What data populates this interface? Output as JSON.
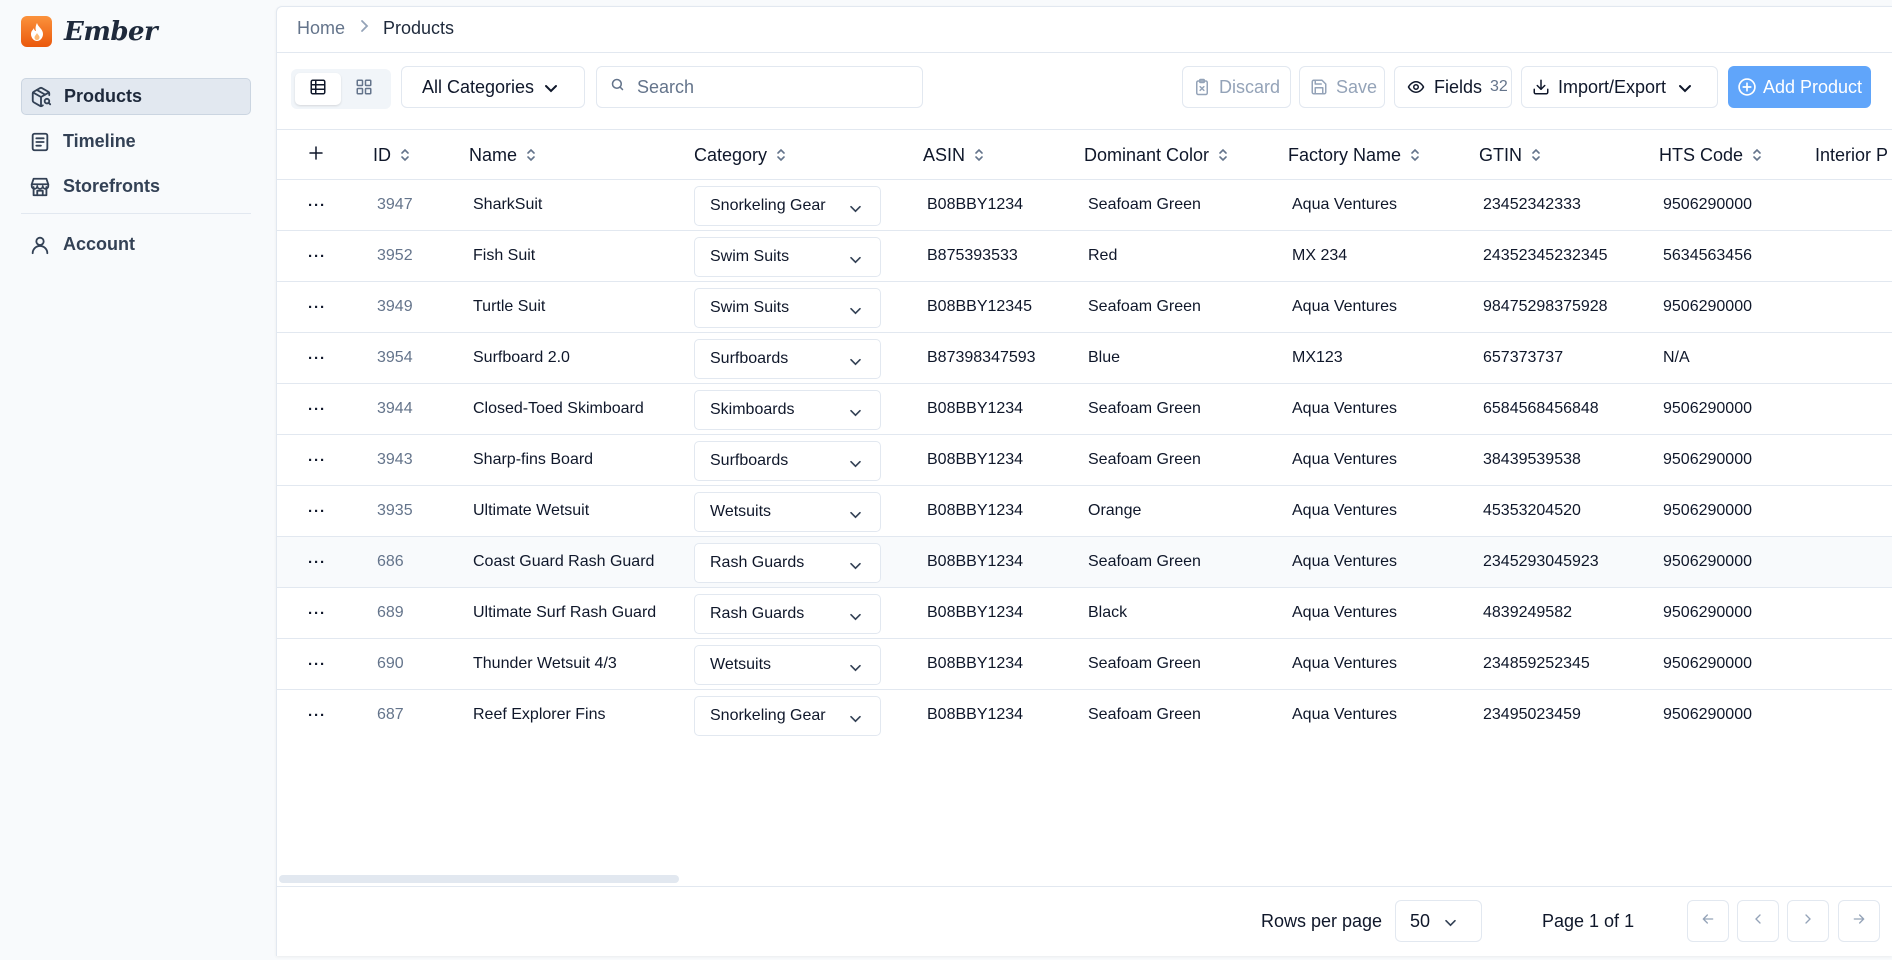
{
  "brand": {
    "name": "Ember"
  },
  "sidebar": {
    "items": [
      {
        "label": "Products",
        "icon": "package-search-icon",
        "active": true
      },
      {
        "label": "Timeline",
        "icon": "timeline-list-icon"
      },
      {
        "label": "Storefronts",
        "icon": "store-icon"
      }
    ],
    "account": {
      "label": "Account",
      "icon": "user-icon"
    }
  },
  "breadcrumb": {
    "home": "Home",
    "current": "Products"
  },
  "toolbar": {
    "category_filter": "All Categories",
    "search_placeholder": "Search",
    "discard_label": "Discard",
    "save_label": "Save",
    "fields_label": "Fields",
    "fields_count": "32",
    "import_export_label": "Import/Export",
    "add_label": "Add Product",
    "accent_color": "#60a5fa"
  },
  "table": {
    "columns": [
      "ID",
      "Name",
      "Category",
      "ASIN",
      "Dominant Color",
      "Factory Name",
      "GTIN",
      "HTS Code",
      "Interior P"
    ],
    "rows": [
      {
        "id": "3947",
        "name": "SharkSuit",
        "category": "Snorkeling Gear",
        "asin": "B08BBY1234",
        "color": "Seafoam Green",
        "factory": "Aqua Ventures",
        "gtin": "23452342333",
        "hts": "9506290000"
      },
      {
        "id": "3952",
        "name": "Fish Suit",
        "category": "Swim Suits",
        "asin": "B875393533",
        "color": "Red",
        "factory": "MX 234",
        "gtin": "24352345232345",
        "hts": "5634563456"
      },
      {
        "id": "3949",
        "name": "Turtle Suit",
        "category": "Swim Suits",
        "asin": "B08BBY12345",
        "color": "Seafoam Green",
        "factory": "Aqua Ventures",
        "gtin": "98475298375928",
        "hts": "9506290000"
      },
      {
        "id": "3954",
        "name": "Surfboard 2.0",
        "category": "Surfboards",
        "asin": "B87398347593",
        "color": "Blue",
        "factory": "MX123",
        "gtin": "657373737",
        "hts": "N/A"
      },
      {
        "id": "3944",
        "name": "Closed-Toed Skimboard",
        "category": "Skimboards",
        "asin": "B08BBY1234",
        "color": "Seafoam Green",
        "factory": "Aqua Ventures",
        "gtin": "6584568456848",
        "hts": "9506290000"
      },
      {
        "id": "3943",
        "name": "Sharp-fins Board",
        "category": "Surfboards",
        "asin": "B08BBY1234",
        "color": "Seafoam Green",
        "factory": "Aqua Ventures",
        "gtin": "38439539538",
        "hts": "9506290000"
      },
      {
        "id": "3935",
        "name": "Ultimate Wetsuit",
        "category": "Wetsuits",
        "asin": "B08BBY1234",
        "color": "Orange",
        "factory": "Aqua Ventures",
        "gtin": "45353204520",
        "hts": "9506290000"
      },
      {
        "id": "686",
        "name": "Coast Guard Rash Guard",
        "category": "Rash Guards",
        "asin": "B08BBY1234",
        "color": "Seafoam Green",
        "factory": "Aqua Ventures",
        "gtin": "2345293045923",
        "hts": "9506290000",
        "highlighted": true
      },
      {
        "id": "689",
        "name": "Ultimate Surf Rash Guard",
        "category": "Rash Guards",
        "asin": "B08BBY1234",
        "color": "Black",
        "factory": "Aqua Ventures",
        "gtin": "4839249582",
        "hts": "9506290000"
      },
      {
        "id": "690",
        "name": "Thunder Wetsuit 4/3",
        "category": "Wetsuits",
        "asin": "B08BBY1234",
        "color": "Seafoam Green",
        "factory": "Aqua Ventures",
        "gtin": "234859252345",
        "hts": "9506290000"
      },
      {
        "id": "687",
        "name": "Reef Explorer Fins",
        "category": "Snorkeling Gear",
        "asin": "B08BBY1234",
        "color": "Seafoam Green",
        "factory": "Aqua Ventures",
        "gtin": "23495023459",
        "hts": "9506290000"
      }
    ]
  },
  "pagination": {
    "rows_per_page_label": "Rows per page",
    "rows_per_page_value": "50",
    "page_info": "Page 1 of 1"
  }
}
